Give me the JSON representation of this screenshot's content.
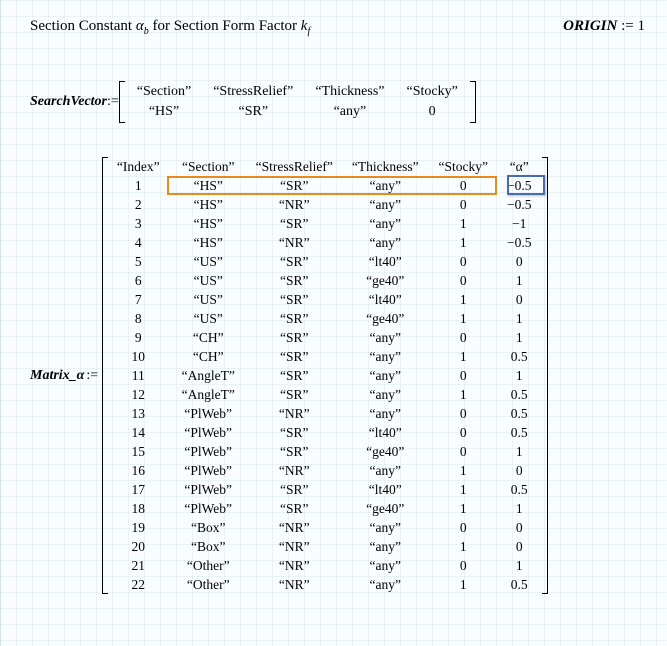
{
  "header": {
    "title_prefix": "Section Constant ",
    "title_sym": "α",
    "title_sub": "b",
    "title_mid": " for Section Form Factor ",
    "title_sym2": "k",
    "title_sub2": "f",
    "origin_label": "ORIGIN",
    "origin_op": ":=",
    "origin_val": "1"
  },
  "search_vector": {
    "label": "SearchVector",
    "op": ":=",
    "headers": [
      "“Section”",
      "“StressRelief”",
      "“Thickness”",
      "“Stocky”"
    ],
    "values": [
      "“HS”",
      "“SR”",
      "“any”",
      "0"
    ]
  },
  "matrix": {
    "label": "Matrix_α",
    "op": ":=",
    "headers": [
      "“Index”",
      "“Section”",
      "“StressRelief”",
      "“Thickness”",
      "“Stocky”",
      "“α”"
    ],
    "rows": [
      [
        "1",
        "“HS”",
        "“SR”",
        "“any”",
        "0",
        "−0.5"
      ],
      [
        "2",
        "“HS”",
        "“NR”",
        "“any”",
        "0",
        "−0.5"
      ],
      [
        "3",
        "“HS”",
        "“SR”",
        "“any”",
        "1",
        "−1"
      ],
      [
        "4",
        "“HS”",
        "“NR”",
        "“any”",
        "1",
        "−0.5"
      ],
      [
        "5",
        "“US”",
        "“SR”",
        "“lt40”",
        "0",
        "0"
      ],
      [
        "6",
        "“US”",
        "“SR”",
        "“ge40”",
        "0",
        "1"
      ],
      [
        "7",
        "“US”",
        "“SR”",
        "“lt40”",
        "1",
        "0"
      ],
      [
        "8",
        "“US”",
        "“SR”",
        "“ge40”",
        "1",
        "1"
      ],
      [
        "9",
        "“CH”",
        "“SR”",
        "“any”",
        "0",
        "1"
      ],
      [
        "10",
        "“CH”",
        "“SR”",
        "“any”",
        "1",
        "0.5"
      ],
      [
        "11",
        "“AngleT”",
        "“SR”",
        "“any”",
        "0",
        "1"
      ],
      [
        "12",
        "“AngleT”",
        "“SR”",
        "“any”",
        "1",
        "0.5"
      ],
      [
        "13",
        "“PlWeb”",
        "“NR”",
        "“any”",
        "0",
        "0.5"
      ],
      [
        "14",
        "“PlWeb”",
        "“SR”",
        "“lt40”",
        "0",
        "0.5"
      ],
      [
        "15",
        "“PlWeb”",
        "“SR”",
        "“ge40”",
        "0",
        "1"
      ],
      [
        "16",
        "“PlWeb”",
        "“NR”",
        "“any”",
        "1",
        "0"
      ],
      [
        "17",
        "“PlWeb”",
        "“SR”",
        "“lt40”",
        "1",
        "0.5"
      ],
      [
        "18",
        "“PlWeb”",
        "“SR”",
        "“ge40”",
        "1",
        "1"
      ],
      [
        "19",
        "“Box”",
        "“NR”",
        "“any”",
        "0",
        "0"
      ],
      [
        "20",
        "“Box”",
        "“NR”",
        "“any”",
        "1",
        "0"
      ],
      [
        "21",
        "“Other”",
        "“NR”",
        "“any”",
        "0",
        "1"
      ],
      [
        "22",
        "“Other”",
        "“NR”",
        "“any”",
        "1",
        "0.5"
      ]
    ]
  }
}
